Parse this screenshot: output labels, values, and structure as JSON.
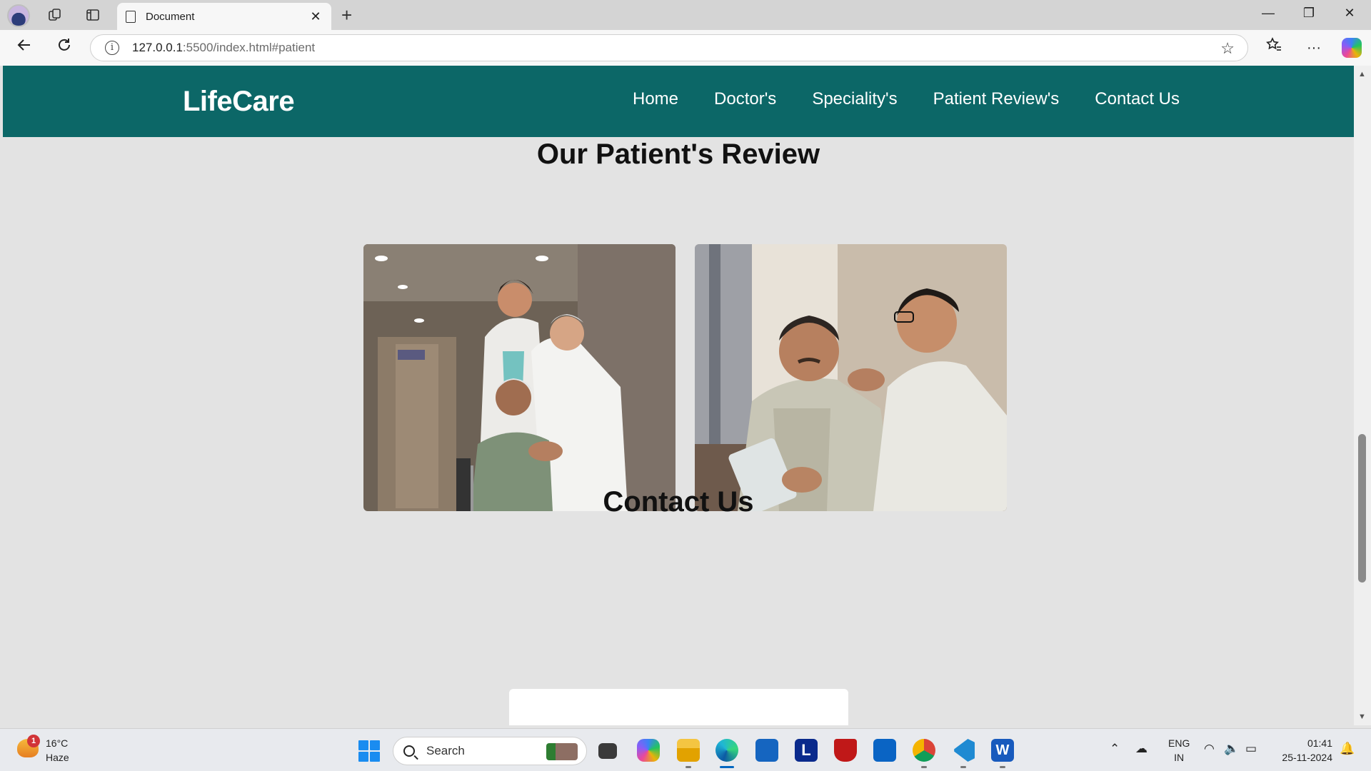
{
  "browser": {
    "tab_title": "Document",
    "tab_close": "✕",
    "new_tab": "+",
    "url_host": "127.0.0.1",
    "url_rest": ":5500/index.html#patient",
    "icons": [
      "profile-avatar",
      "workspaces-icon",
      "vertical-tabs-icon",
      "document-icon",
      "back-icon",
      "refresh-icon",
      "info-icon",
      "favorite-star-icon",
      "favorites-icon",
      "more-icon",
      "copilot-icon"
    ],
    "window_controls": [
      "—",
      "❐",
      "✕"
    ]
  },
  "page": {
    "brand": "LifeCare",
    "nav": [
      "Home",
      "Doctor's",
      "Speciality's",
      "Patient Review's",
      "Contact Us"
    ],
    "review_title": "Our Patient's Review",
    "contact_title": "Contact Us",
    "colors": {
      "navbar": "#0c6767",
      "background": "#e3e3e3"
    }
  },
  "taskbar": {
    "weather_badge": "1",
    "temperature": "16°C",
    "condition": "Haze",
    "search_label": "Search",
    "lang_top": "ENG",
    "lang_bottom": "IN",
    "time": "01:41",
    "date": "25-11-2024",
    "apps": [
      "file-explorer",
      "copilot",
      "folder",
      "edge",
      "store",
      "l-app",
      "mcafee",
      "outlook",
      "chrome",
      "vscode",
      "word"
    ]
  }
}
